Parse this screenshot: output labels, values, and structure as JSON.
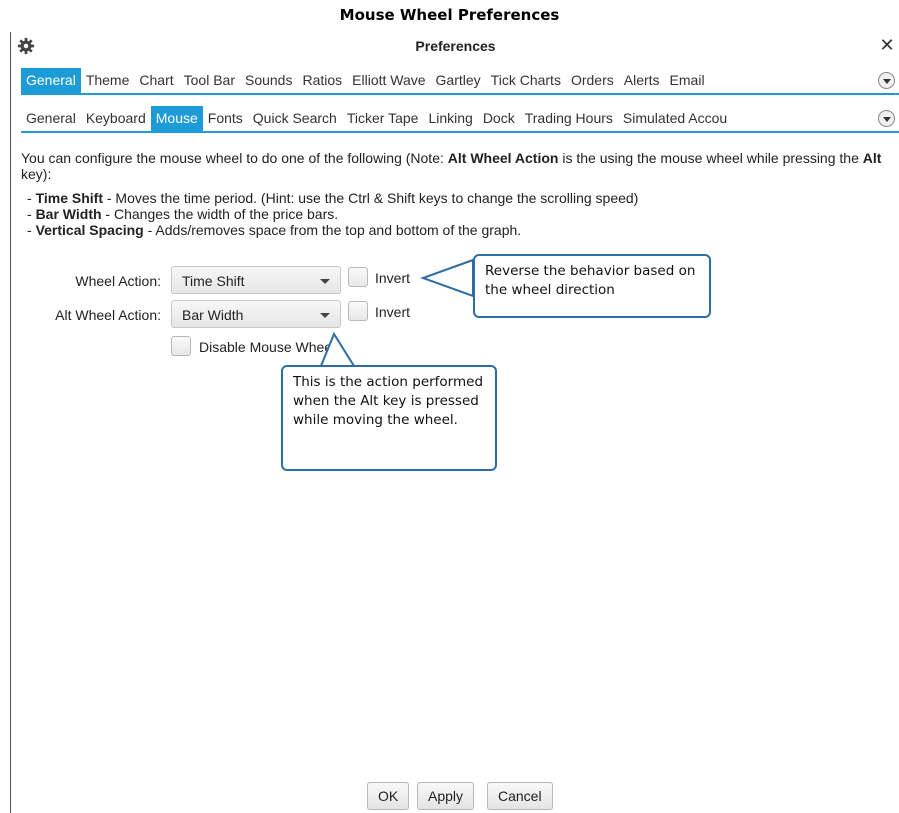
{
  "caption": "Mouse Wheel Preferences",
  "window": {
    "title": "Preferences"
  },
  "main_tabs": [
    {
      "label": "General",
      "active": true
    },
    {
      "label": "Theme",
      "active": false
    },
    {
      "label": "Chart",
      "active": false
    },
    {
      "label": "Tool Bar",
      "active": false
    },
    {
      "label": "Sounds",
      "active": false
    },
    {
      "label": "Ratios",
      "active": false
    },
    {
      "label": "Elliott Wave",
      "active": false
    },
    {
      "label": "Gartley",
      "active": false
    },
    {
      "label": "Tick Charts",
      "active": false
    },
    {
      "label": "Orders",
      "active": false
    },
    {
      "label": "Alerts",
      "active": false
    },
    {
      "label": "Email",
      "active": false
    }
  ],
  "sub_tabs": [
    {
      "label": "General",
      "active": false
    },
    {
      "label": "Keyboard",
      "active": false
    },
    {
      "label": "Mouse",
      "active": true
    },
    {
      "label": "Fonts",
      "active": false
    },
    {
      "label": "Quick Search",
      "active": false
    },
    {
      "label": "Ticker Tape",
      "active": false
    },
    {
      "label": "Linking",
      "active": false
    },
    {
      "label": "Dock",
      "active": false
    },
    {
      "label": "Trading Hours",
      "active": false
    },
    {
      "label": "Simulated Accou",
      "active": false
    }
  ],
  "description": {
    "p1": "You can configure the mouse wheel to do one of the following (Note: ",
    "p1_bold": "Alt Wheel Action",
    "p2": " is the using the mouse wheel while pressing the ",
    "p2_bold": "Alt",
    "p3": " key):"
  },
  "bullets": [
    {
      "term": "Time Shift",
      "text": " - Moves the time period. (Hint: use the Ctrl & Shift keys to change the scrolling speed)"
    },
    {
      "term": "Bar Width",
      "text": " - Changes the width of the price bars."
    },
    {
      "term": "Vertical Spacing",
      "text": " - Adds/removes space from the top and bottom of the graph."
    }
  ],
  "form": {
    "wheel_action_label": "Wheel Action:",
    "wheel_action_value": "Time Shift",
    "alt_wheel_action_label": "Alt Wheel Action:",
    "alt_wheel_action_value": "Bar Width",
    "invert_label": "Invert",
    "disable_label": "Disable Mouse Wheel"
  },
  "callouts": {
    "invert_note": "Reverse the behavior based on the wheel direction",
    "alt_note": "This is the action performed when the Alt key is pressed while moving the wheel."
  },
  "buttons": {
    "ok": "OK",
    "apply": "Apply",
    "cancel": "Cancel"
  },
  "colors": {
    "accent": "#1d9bd6",
    "callout_border": "#2e6da4"
  },
  "icons": [
    "gear-icon",
    "close-icon",
    "chevron-down-icon"
  ]
}
